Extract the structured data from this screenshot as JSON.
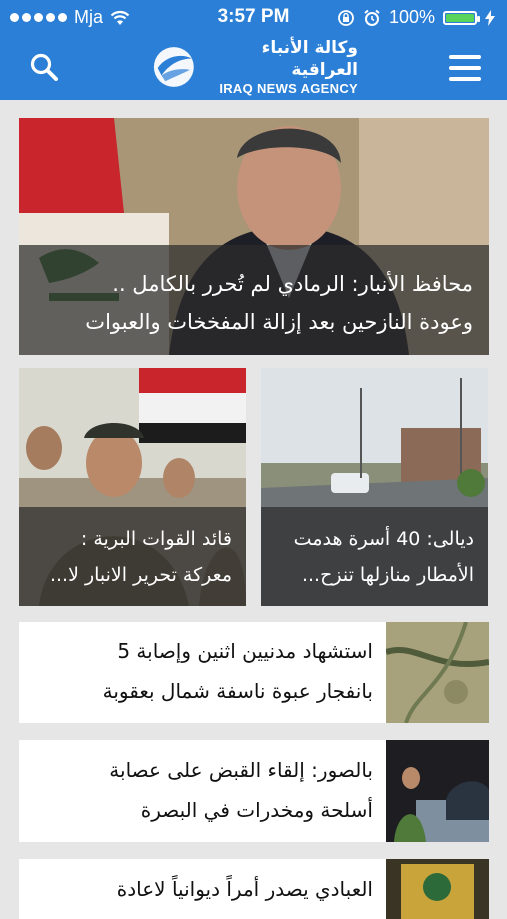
{
  "status_bar": {
    "carrier": "Mja",
    "time": "3:57 PM",
    "battery": "100%"
  },
  "header": {
    "logo_arabic": "وكالة الأنباء العراقية",
    "logo_english": "IRAQ NEWS AGENCY",
    "search_icon": "search-icon",
    "menu_icon": "hamburger-menu-icon"
  },
  "featured": {
    "line1": "محافظ الأنبار: الرمادي لم تُحرر بالكامل ..",
    "line2": "وعودة النازحين بعد إزالة المفخخات والعبوات"
  },
  "cards": [
    {
      "line1": "ديالى: 40 أسرة هدمت",
      "line2": "الأمطار منازلها تنزح..."
    },
    {
      "line1": "قائد القوات البرية :",
      "line2": "معركة تحرير الانبار لا..."
    }
  ],
  "list": [
    {
      "line1": "استشهاد مدنيين اثنين وإصابة 5",
      "line2": "بانفجار عبوة ناسفة شمال بعقوبة"
    },
    {
      "line1": "بالصور: إلقاء القبض على عصابة",
      "line2": "أسلحة ومخدرات في البصرة"
    },
    {
      "line1": "العبادي يصدر أمراً ديوانياً لاعادة",
      "line2": ""
    }
  ]
}
